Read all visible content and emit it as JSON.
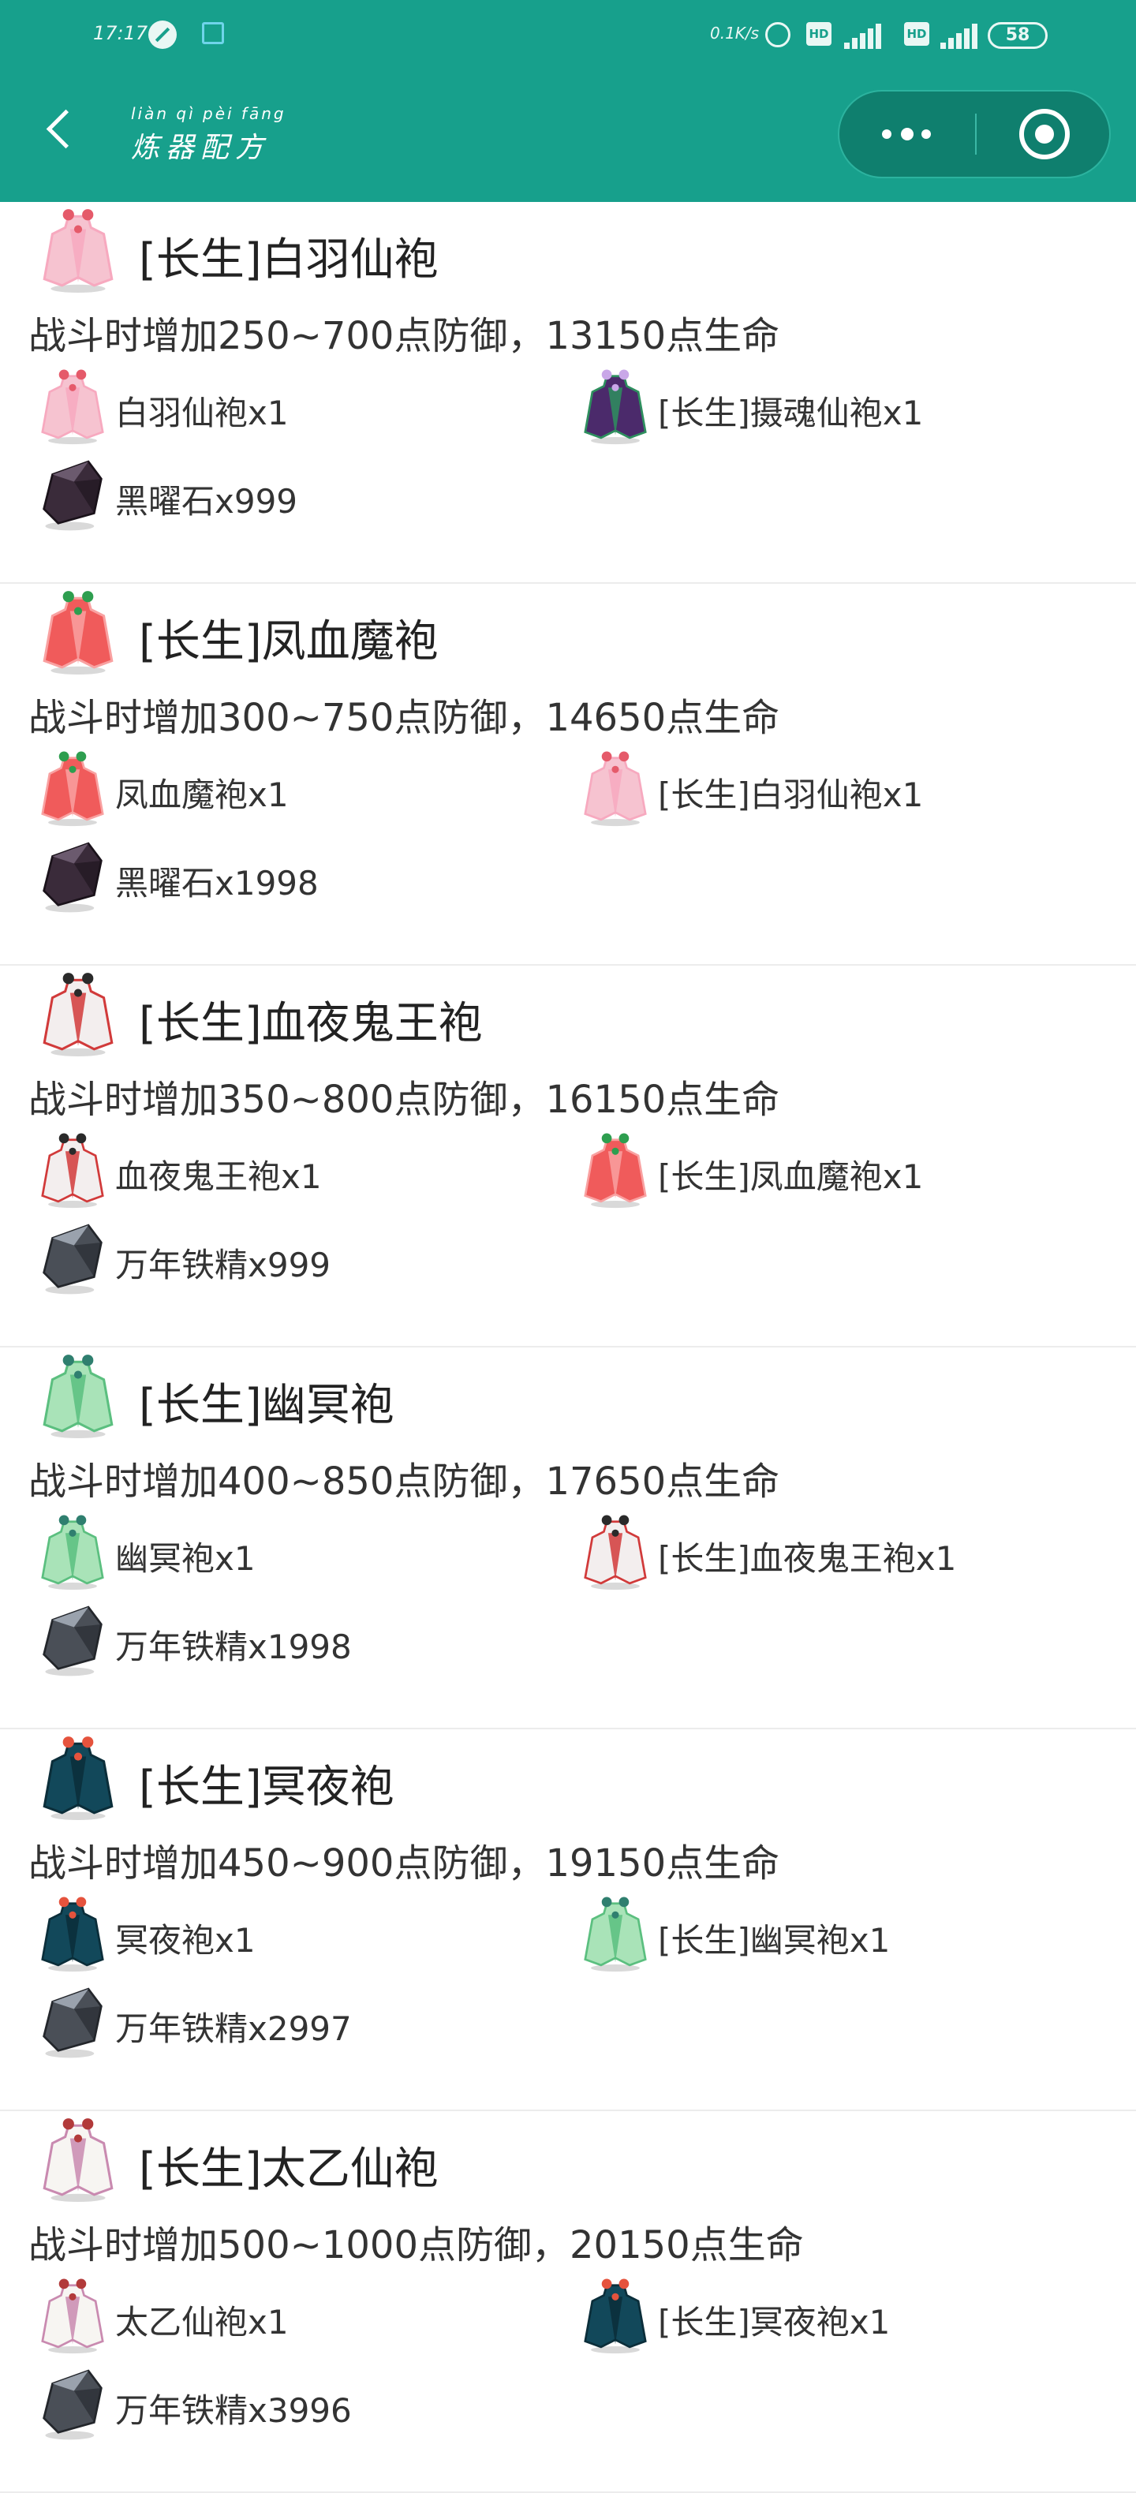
{
  "status_bar": {
    "time": "17:17",
    "network_speed": "0.1K/s",
    "hd_label": "HD",
    "battery": "58",
    "colors": {
      "icon_accent": "#6fd4ea"
    }
  },
  "header": {
    "title": "炼器配方",
    "title_pinyin": "liàn qì pèi fāng",
    "back_icon": "back-chevron-icon",
    "more_icon": "more-dots-icon",
    "close_icon": "target-circle-icon",
    "colors": {
      "bar": "#17a08c",
      "capsule": "#0f7f6e"
    }
  },
  "recipes": [
    {
      "name": "[长生]白羽仙袍",
      "effect": "战斗时增加250~700点防御，13150点生命",
      "icon": "pink-robe",
      "ingredients": [
        {
          "label": "白羽仙袍x1",
          "icon": "pink-robe"
        },
        {
          "label": "[长生]摄魂仙袍x1",
          "icon": "purple-robe"
        },
        {
          "label": "黑曜石x999",
          "icon": "obsidian-stone"
        }
      ]
    },
    {
      "name": "[长生]凤血魔袍",
      "effect": "战斗时增加300~750点防御，14650点生命",
      "icon": "red-robe",
      "ingredients": [
        {
          "label": "凤血魔袍x1",
          "icon": "red-robe"
        },
        {
          "label": "[长生]白羽仙袍x1",
          "icon": "pink-robe"
        },
        {
          "label": "黑曜石x1998",
          "icon": "obsidian-stone"
        }
      ]
    },
    {
      "name": "[长生]血夜鬼王袍",
      "effect": "战斗时增加350~800点防御，16150点生命",
      "icon": "ghost-king-robe",
      "ingredients": [
        {
          "label": "血夜鬼王袍x1",
          "icon": "ghost-king-robe"
        },
        {
          "label": "[长生]凤血魔袍x1",
          "icon": "red-robe"
        },
        {
          "label": "万年铁精x999",
          "icon": "iron-ore"
        }
      ]
    },
    {
      "name": "[长生]幽冥袍",
      "effect": "战斗时增加400~850点防御，17650点生命",
      "icon": "green-robe",
      "ingredients": [
        {
          "label": "幽冥袍x1",
          "icon": "green-robe"
        },
        {
          "label": "[长生]血夜鬼王袍x1",
          "icon": "ghost-king-robe"
        },
        {
          "label": "万年铁精x1998",
          "icon": "iron-ore"
        }
      ]
    },
    {
      "name": "[长生]冥夜袍",
      "effect": "战斗时增加450~900点防御，19150点生命",
      "icon": "dark-teal-robe",
      "ingredients": [
        {
          "label": "冥夜袍x1",
          "icon": "dark-teal-robe"
        },
        {
          "label": "[长生]幽冥袍x1",
          "icon": "green-robe"
        },
        {
          "label": "万年铁精x2997",
          "icon": "iron-ore"
        }
      ]
    },
    {
      "name": "[长生]太乙仙袍",
      "effect": "战斗时增加500~1000点防御，20150点生命",
      "icon": "white-robe",
      "ingredients": [
        {
          "label": "太乙仙袍x1",
          "icon": "white-robe"
        },
        {
          "label": "[长生]冥夜袍x1",
          "icon": "dark-teal-robe"
        },
        {
          "label": "万年铁精x3996",
          "icon": "iron-ore"
        }
      ]
    }
  ],
  "icon_colors": {
    "pink-robe": {
      "body": "#f6c3d0",
      "trim": "#f7a9bf",
      "accent": "#e55a6a"
    },
    "purple-robe": {
      "body": "#4b2a6b",
      "trim": "#2e8f5e",
      "accent": "#c9a7e8"
    },
    "red-robe": {
      "body": "#f05b5b",
      "trim": "#f9a1a1",
      "accent": "#2e9e4f"
    },
    "ghost-king-robe": {
      "body": "#f3eeee",
      "trim": "#d13a3a",
      "accent": "#2a2a2a"
    },
    "green-robe": {
      "body": "#a9e3b8",
      "trim": "#5bbf7f",
      "accent": "#2f7f6f"
    },
    "dark-teal-robe": {
      "body": "#12485a",
      "trim": "#0b2e3a",
      "accent": "#e5533d"
    },
    "white-robe": {
      "body": "#f7f5f2",
      "trim": "#c98ab0",
      "accent": "#b23a3a"
    },
    "obsidian-stone": {
      "body": "#3a2b3a",
      "trim": "#6b5a6e",
      "accent": "#1a121a"
    },
    "iron-ore": {
      "body": "#4a4f57",
      "trim": "#9aa2ad",
      "accent": "#23262b"
    }
  }
}
